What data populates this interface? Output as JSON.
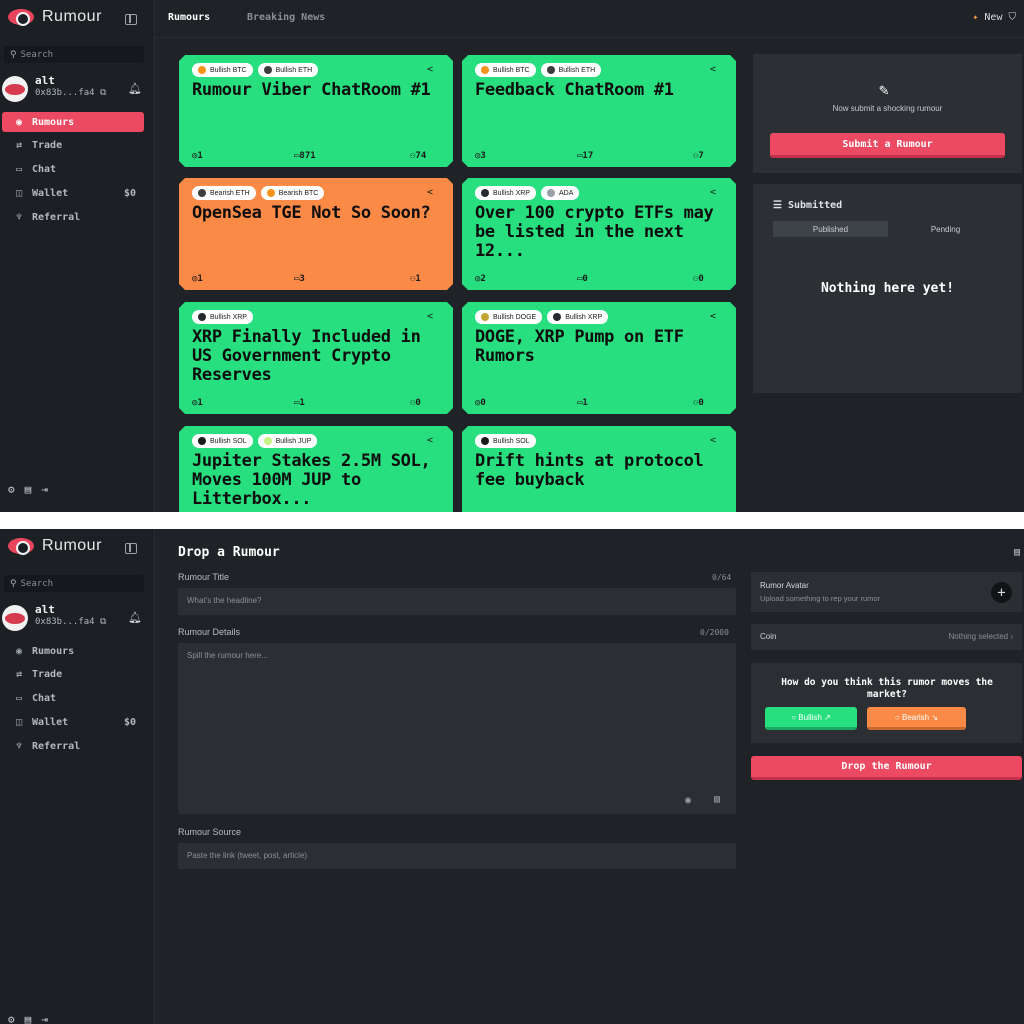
{
  "app": {
    "name": "Rumour"
  },
  "sidebar": {
    "search_placeholder": "Search",
    "user": {
      "name": "alt",
      "address": "0x83b...fa4"
    },
    "items": [
      {
        "label": "Rumours",
        "icon": "eye-icon",
        "value": ""
      },
      {
        "label": "Trade",
        "icon": "swap-icon",
        "value": ""
      },
      {
        "label": "Chat",
        "icon": "chat-icon",
        "value": ""
      },
      {
        "label": "Wallet",
        "icon": "wallet-icon",
        "value": "$0"
      },
      {
        "label": "Referral",
        "icon": "trophy-icon",
        "value": ""
      }
    ]
  },
  "header": {
    "tabs": [
      {
        "label": "Rumours"
      },
      {
        "label": "Breaking News"
      }
    ],
    "new_label": "New"
  },
  "cards": [
    {
      "color": "green",
      "tags": [
        {
          "label": "Bullish BTC",
          "dot": "#f7931a"
        },
        {
          "label": "Bullish ETH",
          "dot": "#3c3c3d"
        }
      ],
      "title": "Rumour Viber ChatRoom #1",
      "views": "1",
      "comments": "871",
      "members": "74"
    },
    {
      "color": "green",
      "tags": [
        {
          "label": "Bullish BTC",
          "dot": "#f7931a"
        },
        {
          "label": "Bullish ETH",
          "dot": "#3c3c3d"
        }
      ],
      "title": "Feedback ChatRoom #1",
      "views": "3",
      "comments": "17",
      "members": "7"
    },
    {
      "color": "orange",
      "tags": [
        {
          "label": "Bearish ETH",
          "dot": "#3c3c3d"
        },
        {
          "label": "Bearish BTC",
          "dot": "#f7931a"
        }
      ],
      "title": "OpenSea TGE Not So Soon?",
      "views": "1",
      "comments": "3",
      "members": "1"
    },
    {
      "color": "green",
      "tags": [
        {
          "label": "Bullish XRP",
          "dot": "#23292f"
        },
        {
          "label": "ADA",
          "dot": "#9aa0a8"
        }
      ],
      "title": "Over 100 crypto ETFs may be listed in the next 12...",
      "views": "2",
      "comments": "0",
      "members": "0"
    },
    {
      "color": "green",
      "tags": [
        {
          "label": "Bullish XRP",
          "dot": "#23292f"
        }
      ],
      "title": "XRP Finally Included in US Government Crypto Reserves",
      "views": "1",
      "comments": "1",
      "members": "0"
    },
    {
      "color": "green",
      "tags": [
        {
          "label": "Bullish DOGE",
          "dot": "#c2a633"
        },
        {
          "label": "Bullish XRP",
          "dot": "#23292f"
        }
      ],
      "title": "DOGE, XRP Pump on ETF Rumors",
      "views": "0",
      "comments": "1",
      "members": "0"
    },
    {
      "color": "green",
      "tags": [
        {
          "label": "Bullish SOL",
          "dot": "#1a1a1a"
        },
        {
          "label": "Bullish JUP",
          "dot": "#c7f284"
        }
      ],
      "title": "Jupiter Stakes 2.5M SOL, Moves 100M JUP to Litterbox...",
      "views": "",
      "comments": "",
      "members": ""
    },
    {
      "color": "green",
      "tags": [
        {
          "label": "Bullish SOL",
          "dot": "#1a1a1a"
        }
      ],
      "title": "Drift hints at protocol fee buyback",
      "views": "",
      "comments": "",
      "members": ""
    }
  ],
  "submit_panel": {
    "text": "Now submit a shocking rumour",
    "button": "Submit a Rumour"
  },
  "submitted_panel": {
    "title": "Submitted",
    "tabs": [
      "Published",
      "Pending"
    ],
    "empty": "Nothing here yet!"
  },
  "form": {
    "title": "Drop a Rumour",
    "title_label": "Rumour Title",
    "title_count": "0/64",
    "title_placeholder": "What's the headline?",
    "details_label": "Rumour Details",
    "details_count": "0/2000",
    "details_placeholder": "Spill the rumour here...",
    "source_label": "Rumour Source",
    "source_placeholder": "Paste the link (tweet, post, article)",
    "avatar_label": "Rumor Avatar",
    "avatar_sub": "Upload something to rep your rumor",
    "coin_label": "Coin",
    "coin_value": "Nothing selected",
    "question": "How do you think this rumor moves the market?",
    "bullish": "Bullish",
    "bearish": "Bearish",
    "drop_button": "Drop the Rumour"
  },
  "colors": {
    "accent": "#ec4a62",
    "bull": "#28df7f",
    "bear": "#fb8a46",
    "bg": "#1f2226"
  }
}
